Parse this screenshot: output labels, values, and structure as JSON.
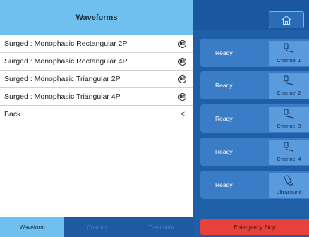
{
  "waveforms": {
    "title": "Waveforms",
    "items": [
      {
        "label": "Surged : Monophasic Rectangular 2P"
      },
      {
        "label": "Surged : Monophasic Rectangular 4P"
      },
      {
        "label": "Surged : Monophasic Triangular 2P"
      },
      {
        "label": "Surged : Monophasic Triangular 4P"
      }
    ],
    "back_label": "Back",
    "back_chevron": "<"
  },
  "tabs": [
    {
      "label": "Waveform"
    },
    {
      "label": "Custom"
    },
    {
      "label": "Treatment"
    }
  ],
  "channels": [
    {
      "status": "Ready",
      "label": "Channel 1"
    },
    {
      "status": "Ready",
      "label": "Channel 2"
    },
    {
      "status": "Ready",
      "label": "Channel  3"
    },
    {
      "status": "Ready",
      "label": "Channel  4"
    },
    {
      "status": "Ready",
      "label": "Ultrasound"
    }
  ],
  "emergency_stop": {
    "label": "Emergency Stop"
  },
  "colors": {
    "header": "#6fc0ef",
    "panel": "#1f5fa8",
    "channel_row": "#3a7cc6",
    "channel_button": "#5a9bde",
    "emergency": "#e8413c"
  }
}
